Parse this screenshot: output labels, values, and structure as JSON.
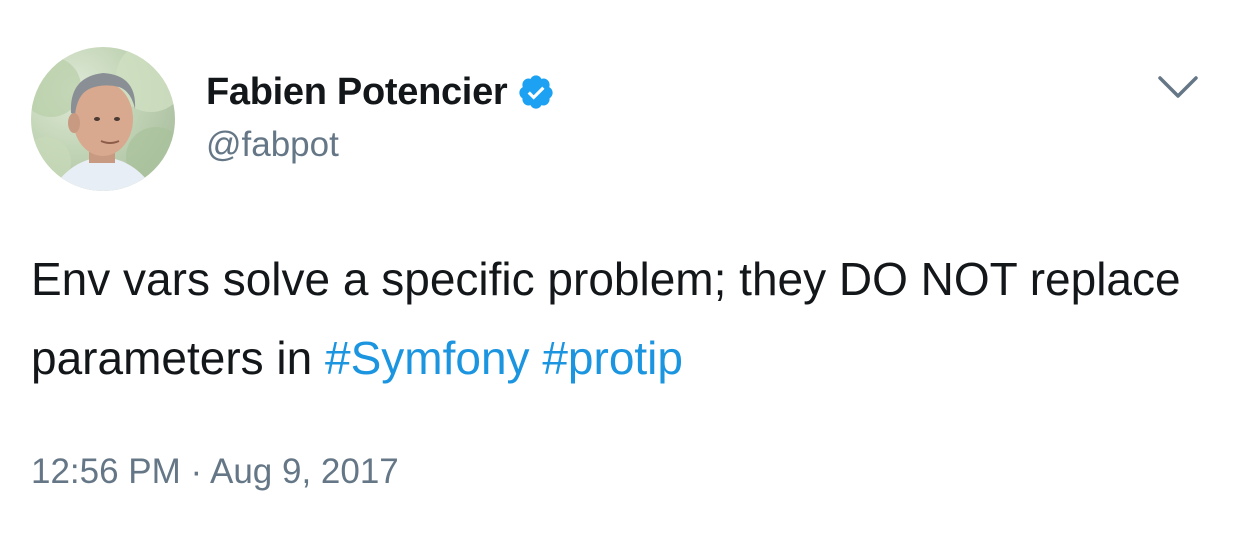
{
  "tweet": {
    "author": {
      "display_name": "Fabien Potencier",
      "handle": "@fabpot",
      "verified": true,
      "avatar_icon": "profile-photo"
    },
    "menu_icon": "chevron-down-icon",
    "text": {
      "segments": [
        "Env vars solve a specific problem; they DO NOT replace parameters in "
      ],
      "hashtags": [
        "#Symfony",
        "#protip"
      ]
    },
    "meta": {
      "time": "12:56 PM",
      "separator": "·",
      "date": "Aug 9, 2017"
    }
  },
  "colors": {
    "text_primary": "#14171a",
    "text_secondary": "#657786",
    "link": "#1b95e0",
    "verified_badge": "#1da1f2"
  }
}
